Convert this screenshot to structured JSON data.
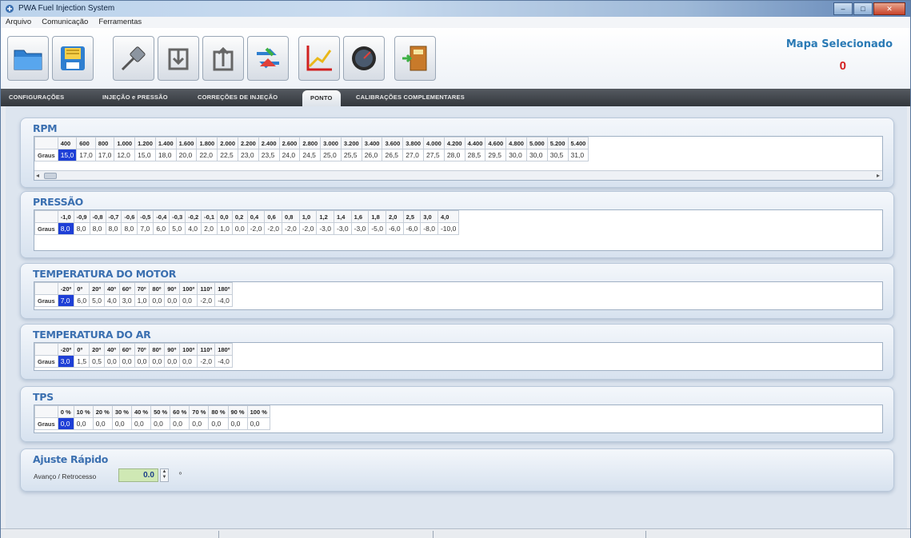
{
  "window": {
    "title": "PWA Fuel Injection System",
    "controls": [
      "–",
      "□",
      "✕"
    ]
  },
  "menu": [
    "Arquivo",
    "Comunicação",
    "Ferramentas"
  ],
  "toolbar": {
    "icons": [
      "open-folder-icon",
      "save-floppy-icon",
      "serial-cable-icon",
      "download-map-icon",
      "upload-map-icon",
      "transfer-arrows-icon",
      "chart-icon",
      "gauge-icon",
      "exit-door-icon"
    ]
  },
  "mapa": {
    "label": "Mapa Selecionado",
    "value": "0"
  },
  "tabs": [
    "CONFIGURAÇÕES",
    "INJEÇÃO e PRESSÃO",
    "CORREÇÕES DE INJEÇÃO",
    "PONTO",
    "CALIBRAÇÕES COMPLEMENTARES"
  ],
  "active_tab": "PONTO",
  "row_label": "Graus",
  "sections": {
    "rpm": {
      "title": "RPM",
      "headers": [
        "400",
        "600",
        "800",
        "1.000",
        "1.200",
        "1.400",
        "1.600",
        "1.800",
        "2.000",
        "2.200",
        "2.400",
        "2.600",
        "2.800",
        "3.000",
        "3.200",
        "3.400",
        "3.600",
        "3.800",
        "4.000",
        "4.200",
        "4.400",
        "4.600",
        "4.800",
        "5.000",
        "5.200",
        "5.400"
      ],
      "values": [
        "15,0",
        "17,0",
        "17,0",
        "12,0",
        "15,0",
        "18,0",
        "20,0",
        "22,0",
        "22,5",
        "23,0",
        "23,5",
        "24,0",
        "24,5",
        "25,0",
        "25,5",
        "26,0",
        "26,5",
        "27,0",
        "27,5",
        "28,0",
        "28,5",
        "29,5",
        "30,0",
        "30,0",
        "30,5",
        "31,0"
      ]
    },
    "pressao": {
      "title": "PRESSÃO",
      "headers": [
        "-1,0",
        "-0,9",
        "-0,8",
        "-0,7",
        "-0,6",
        "-0,5",
        "-0,4",
        "-0,3",
        "-0,2",
        "-0,1",
        "0,0",
        "0,2",
        "0,4",
        "0,6",
        "0,8",
        "1,0",
        "1,2",
        "1,4",
        "1,6",
        "1,8",
        "2,0",
        "2,5",
        "3,0",
        "4,0"
      ],
      "values": [
        "8,0",
        "8,0",
        "8,0",
        "8,0",
        "8,0",
        "7,0",
        "6,0",
        "5,0",
        "4,0",
        "2,0",
        "1,0",
        "0,0",
        "-2,0",
        "-2,0",
        "-2,0",
        "-2,0",
        "-3,0",
        "-3,0",
        "-3,0",
        "-5,0",
        "-6,0",
        "-6,0",
        "-8,0",
        "-10,0"
      ]
    },
    "motor": {
      "title": "TEMPERATURA DO MOTOR",
      "headers": [
        "-20º",
        "0º",
        "20º",
        "40º",
        "60º",
        "70º",
        "80º",
        "90º",
        "100º",
        "110º",
        "180º"
      ],
      "values": [
        "7,0",
        "6,0",
        "5,0",
        "4,0",
        "3,0",
        "1,0",
        "0,0",
        "0,0",
        "0,0",
        "-2,0",
        "-4,0"
      ]
    },
    "ar": {
      "title": "TEMPERATURA DO AR",
      "headers": [
        "-20º",
        "0º",
        "20º",
        "40º",
        "60º",
        "70º",
        "80º",
        "90º",
        "100º",
        "110º",
        "180º"
      ],
      "values": [
        "3,0",
        "1,5",
        "0,5",
        "0,0",
        "0,0",
        "0,0",
        "0,0",
        "0,0",
        "0,0",
        "-2,0",
        "-4,0"
      ]
    },
    "tps": {
      "title": "TPS",
      "headers": [
        "0 %",
        "10 %",
        "20 %",
        "30 %",
        "40 %",
        "50 %",
        "60 %",
        "70 %",
        "80 %",
        "90 %",
        "100 %"
      ],
      "values": [
        "0,0",
        "0,0",
        "0,0",
        "0,0",
        "0,0",
        "0,0",
        "0,0",
        "0,0",
        "0,0",
        "0,0",
        "0,0"
      ]
    }
  },
  "ajuste": {
    "title": "Ajuste Rápido",
    "label": "Avanço / Retrocesso",
    "value": "0.0",
    "unit": "º"
  },
  "colors": {
    "accent_title": "#3a6fb0",
    "selected_cell": "#1e3fd6",
    "mapa_label": "#2a7ab5",
    "mapa_value": "#d42020"
  }
}
